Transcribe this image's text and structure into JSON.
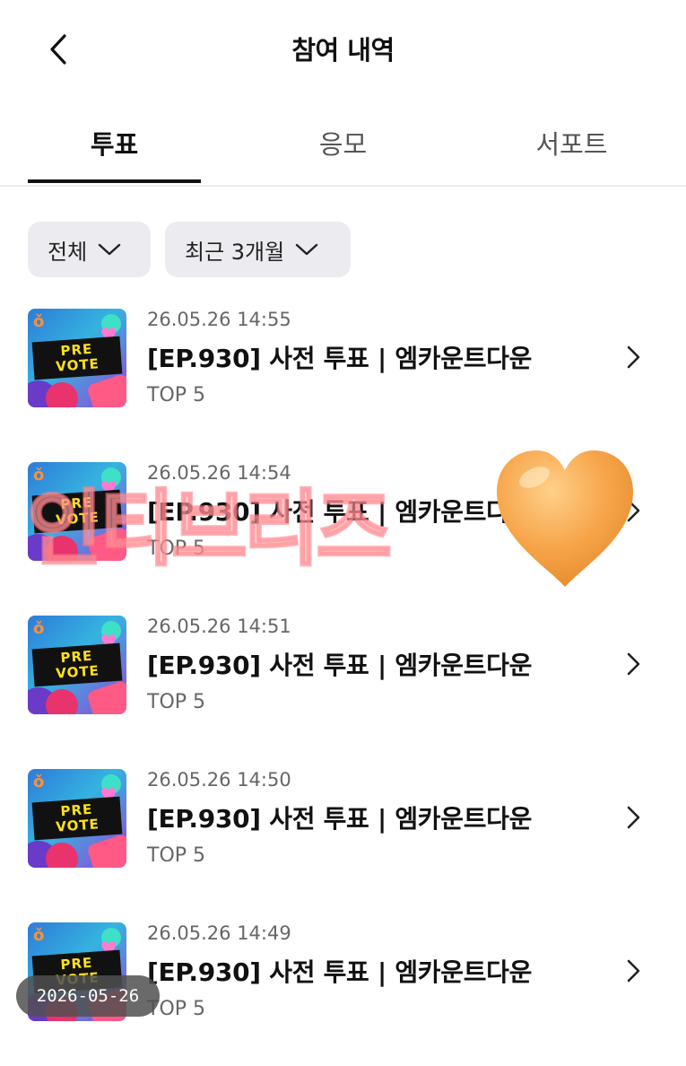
{
  "header": {
    "title": "참여 내역"
  },
  "tabs": [
    {
      "label": "투표",
      "active": true
    },
    {
      "label": "응모",
      "active": false
    },
    {
      "label": "서포트",
      "active": false
    }
  ],
  "filters": {
    "category": "전체",
    "period": "최근 3개월"
  },
  "thumbnail_text": {
    "line1": "PRE",
    "line2": "VOTE"
  },
  "items": [
    {
      "datetime": "26.05.26 14:55",
      "title": "[EP.930] 사전 투표 | 엠카운트다운",
      "subtitle": "TOP 5"
    },
    {
      "datetime": "26.05.26 14:54",
      "title": "[EP.930] 사전 투표 | 엠카운트다운",
      "subtitle": "TOP 5"
    },
    {
      "datetime": "26.05.26 14:51",
      "title": "[EP.930] 사전 투표 | 엠카운트다운",
      "subtitle": "TOP 5"
    },
    {
      "datetime": "26.05.26 14:50",
      "title": "[EP.930] 사전 투표 | 엠카운트다운",
      "subtitle": "TOP 5"
    },
    {
      "datetime": "26.05.26 14:49",
      "title": "[EP.930] 사전 투표 | 엠카운트다운",
      "subtitle": "TOP 5"
    }
  ],
  "overlay": {
    "watermark": "인티브리즈",
    "date_stamp": "2026-05-26",
    "heart_color": "#F7A54A"
  },
  "colors": {
    "accent": "#111111",
    "chip_bg": "#ECECF0"
  }
}
